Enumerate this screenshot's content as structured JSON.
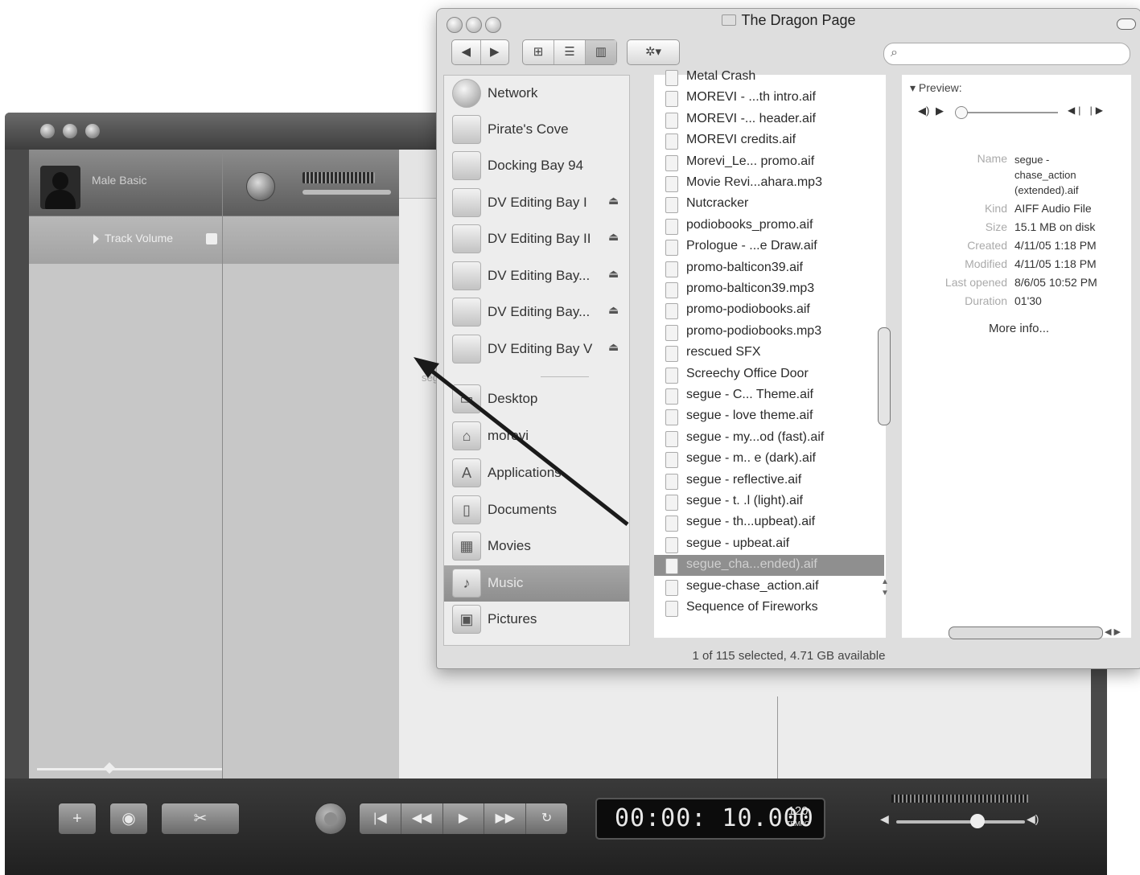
{
  "garageband": {
    "track_name": "Male Basic",
    "track_volume_label": "Track Volume",
    "timeline_fragment": "seg",
    "controls": {
      "add": "+",
      "lcd_time": "00:00: 10.000",
      "tempo_value": "120",
      "tempo_label": "TEMPO"
    }
  },
  "finder": {
    "title": "The Dragon Page",
    "toolbar": {
      "back": "◀",
      "forward": "▶",
      "view_icon": "⊞",
      "view_list": "☰",
      "view_column": "▥",
      "action": "✲▾"
    },
    "search": {
      "icon": "magnifier-icon",
      "placeholder": ""
    },
    "sidebar": [
      {
        "label": "Network",
        "icon": "network-icon",
        "eject": false
      },
      {
        "label": "Pirate's Cove",
        "icon": "hard-drive-icon",
        "eject": false
      },
      {
        "label": "Docking Bay 94",
        "icon": "hard-drive-icon",
        "eject": false
      },
      {
        "label": "DV Editing Bay I",
        "icon": "firewire-drive-icon",
        "eject": true
      },
      {
        "label": "DV Editing Bay II",
        "icon": "firewire-drive-icon",
        "eject": true
      },
      {
        "label": "DV Editing Bay...",
        "icon": "firewire-drive-icon",
        "eject": true
      },
      {
        "label": "DV Editing Bay...",
        "icon": "firewire-drive-icon",
        "eject": true
      },
      {
        "label": "DV Editing Bay V",
        "icon": "firewire-drive-icon",
        "eject": true
      },
      {
        "label": "Desktop",
        "icon": "desktop-icon",
        "eject": false
      },
      {
        "label": "morevi",
        "icon": "home-icon",
        "eject": false
      },
      {
        "label": "Applications",
        "icon": "applications-icon",
        "eject": false
      },
      {
        "label": "Documents",
        "icon": "documents-icon",
        "eject": false
      },
      {
        "label": "Movies",
        "icon": "movies-icon",
        "eject": false
      },
      {
        "label": "Music",
        "icon": "music-icon",
        "eject": false,
        "selected": true
      },
      {
        "label": "Pictures",
        "icon": "pictures-icon",
        "eject": false
      }
    ],
    "files": [
      "Metal Crash",
      "MOREVI - ...th intro.aif",
      "MOREVI -... header.aif",
      "MOREVI credits.aif",
      "Morevi_Le... promo.aif",
      "Movie Revi...ahara.mp3",
      "Nutcracker",
      "podiobooks_promo.aif",
      "Prologue - ...e Draw.aif",
      "promo-balticon39.aif",
      "promo-balticon39.mp3",
      "promo-podiobooks.aif",
      "promo-podiobooks.mp3",
      "rescued SFX",
      "Screechy Office Door",
      "segue - C... Theme.aif",
      "segue - love theme.aif",
      "segue - my...od (fast).aif",
      "segue - m.. e (dark).aif",
      "segue - reflective.aif",
      "segue - t. .l (light).aif",
      "segue - th...upbeat).aif",
      "segue - upbeat.aif",
      "segue_cha...ended).aif",
      "segue-chase_action.aif",
      "Sequence of Fireworks"
    ],
    "selected_file_index": 23,
    "preview": {
      "heading": "Preview:",
      "name_label": "Name",
      "name_value_1": "segue -",
      "name_value_2": "chase_action",
      "name_value_3": "(extended).aif",
      "kind_label": "Kind",
      "kind_value": "AIFF Audio File",
      "size_label": "Size",
      "size_value": "15.1 MB on disk",
      "created_label": "Created",
      "created_value": "4/11/05 1:18 PM",
      "modified_label": "Modified",
      "modified_value": "4/11/05 1:18 PM",
      "opened_label": "Last opened",
      "opened_value": "8/6/05 10:52 PM",
      "duration_label": "Duration",
      "duration_value": "01'30",
      "more_info": "More info..."
    },
    "status": "1 of 115 selected, 4.71 GB available"
  }
}
